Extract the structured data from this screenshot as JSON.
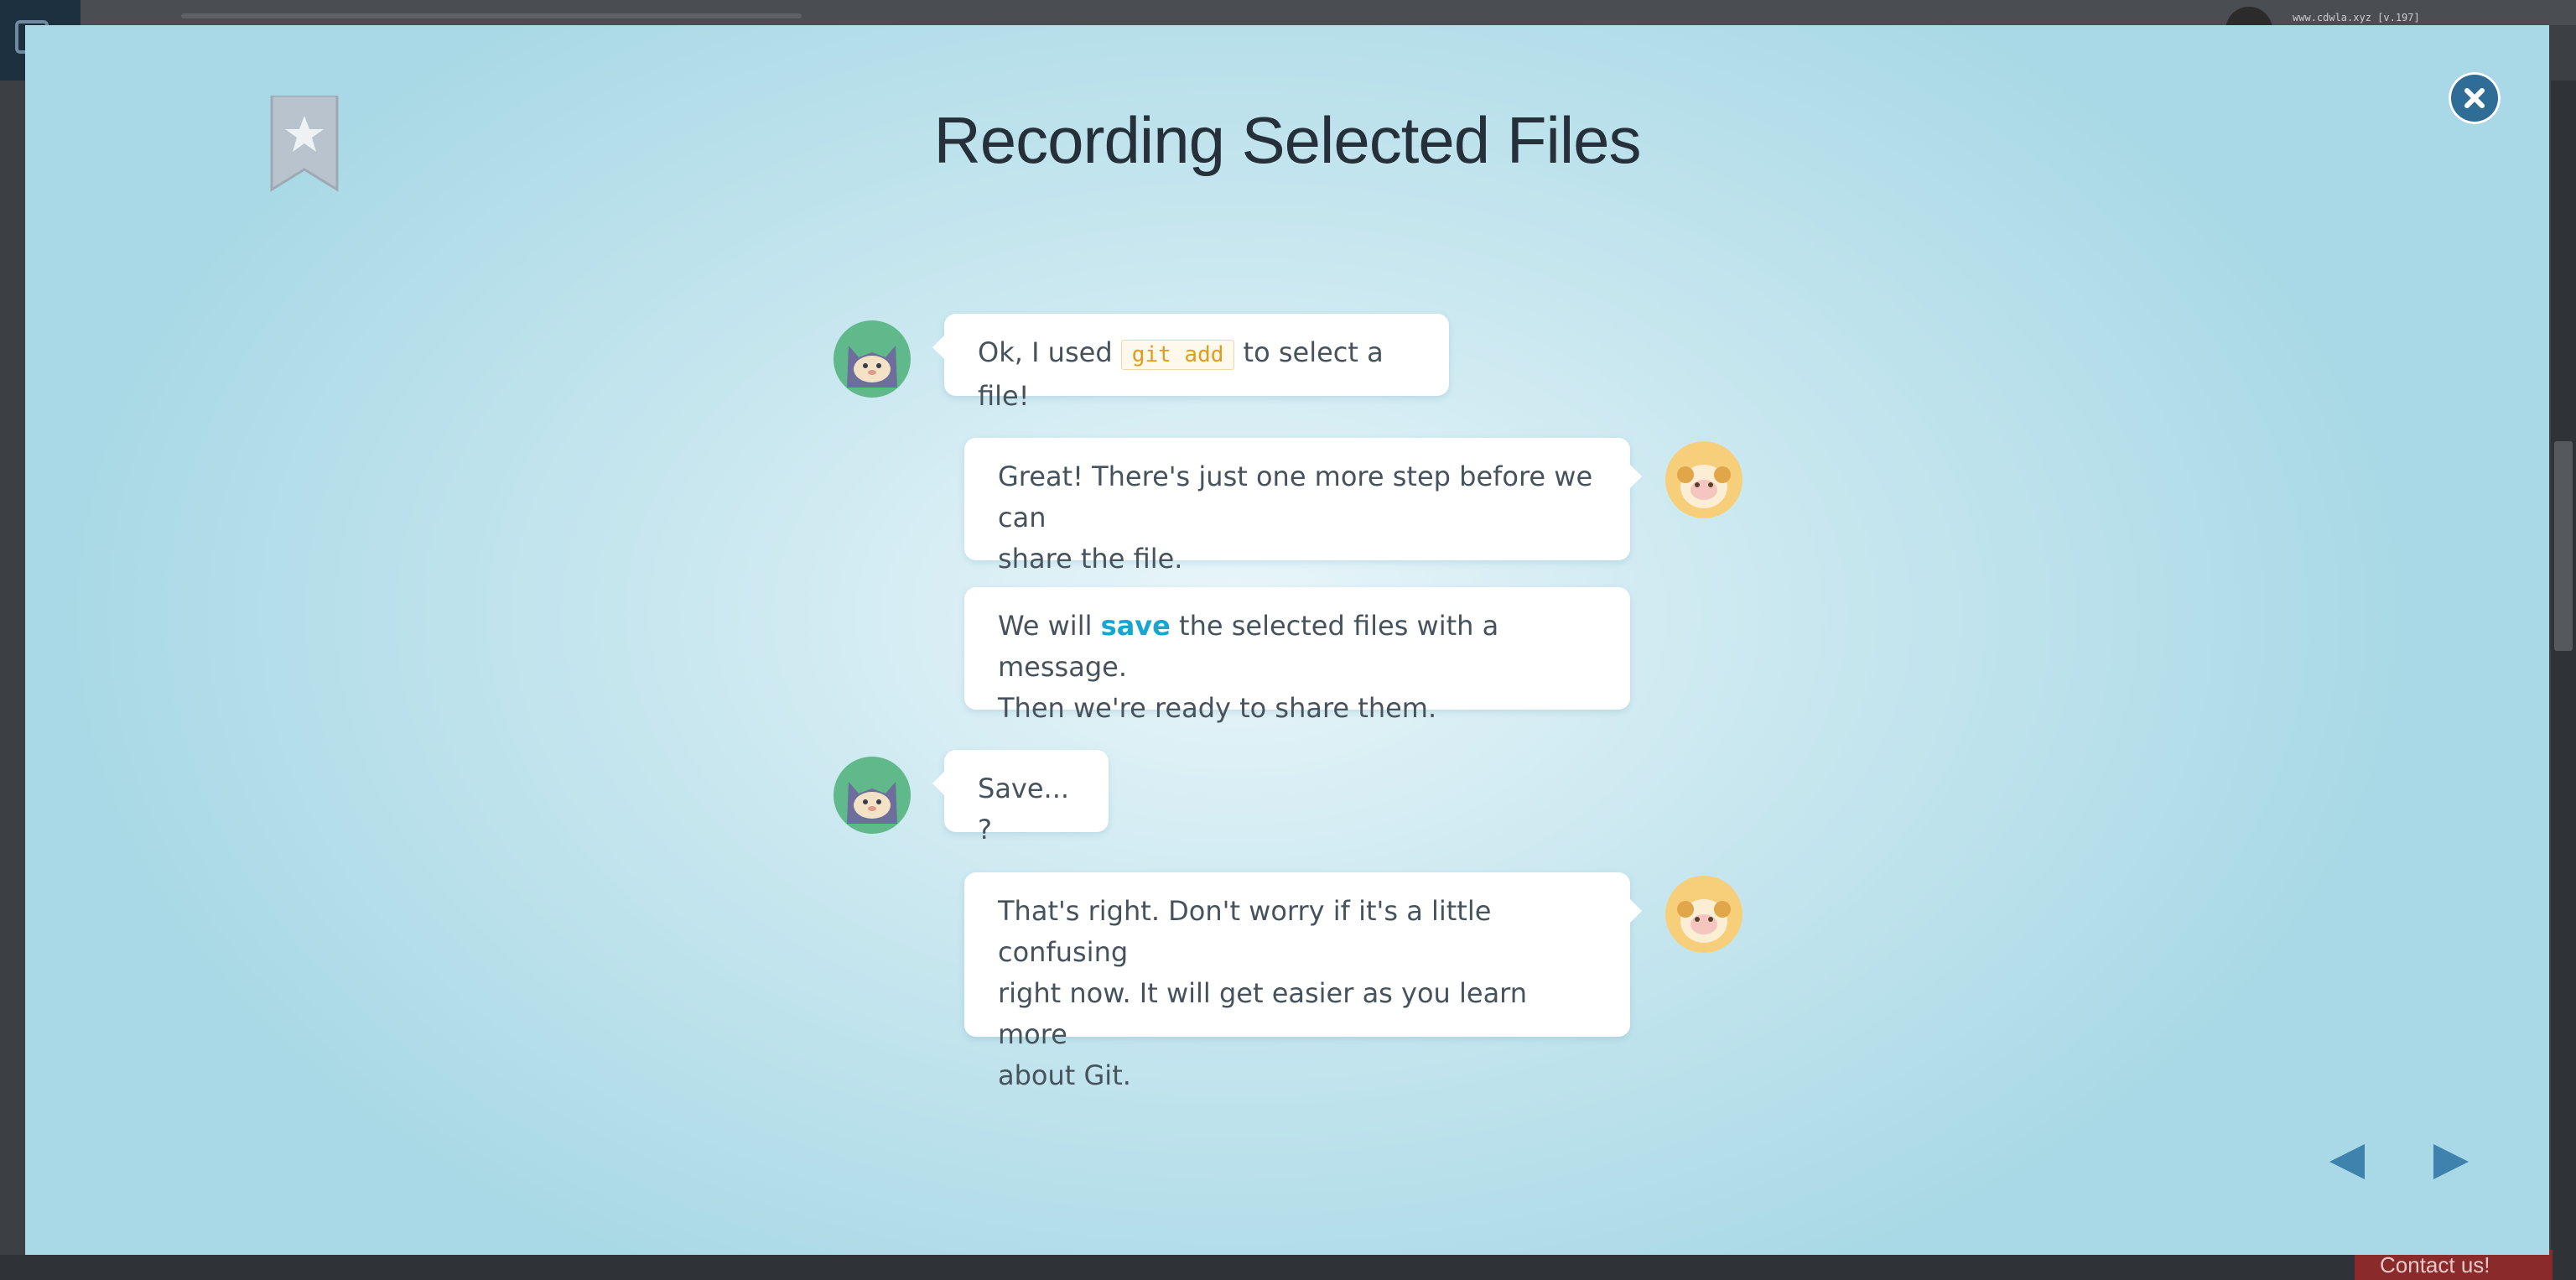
{
  "background": {
    "header_text": "www.cdwla.xyz [v.197]",
    "contact_label": "Contact us!"
  },
  "modal": {
    "title": "Recording Selected Files",
    "icons": {
      "bookmark": "bookmark-star-icon",
      "close": "close-icon",
      "prev": "prev-arrow-icon",
      "next": "next-arrow-icon"
    },
    "colors": {
      "title": "#25303a",
      "code": "#e39b1b",
      "highlight": "#1aa4cf",
      "close_button": "#2f6d96"
    }
  },
  "chat": {
    "m1": {
      "speaker": "cat",
      "before": "Ok, I used ",
      "code": "git add",
      "after": " to select a file!"
    },
    "m2": {
      "speaker": "sheep",
      "line1": "Great! There's just one more step before we can",
      "line2": "share the file."
    },
    "m3": {
      "speaker": "sheep",
      "before": "We will ",
      "highlight": "save",
      "after": " the selected files with a message.",
      "line2": "Then we're ready to share them."
    },
    "m4": {
      "speaker": "cat",
      "text": "Save... ?"
    },
    "m5": {
      "speaker": "sheep",
      "line1": "That's right. Don't worry if it's a little confusing",
      "line2": "right now. It will get easier as you learn more",
      "line3": "about Git."
    }
  }
}
